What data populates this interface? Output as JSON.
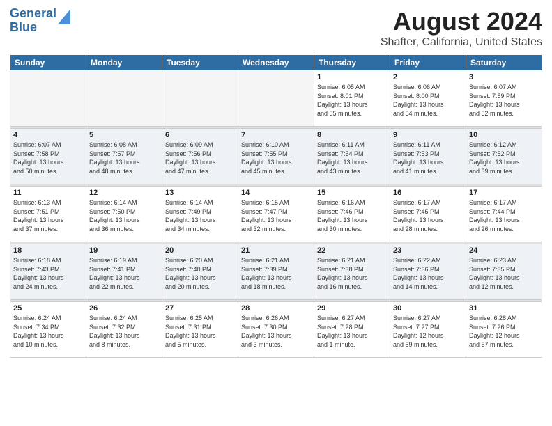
{
  "header": {
    "logo_line1": "General",
    "logo_line2": "Blue",
    "title": "August 2024",
    "subtitle": "Shafter, California, United States"
  },
  "days_of_week": [
    "Sunday",
    "Monday",
    "Tuesday",
    "Wednesday",
    "Thursday",
    "Friday",
    "Saturday"
  ],
  "weeks": [
    {
      "days": [
        {
          "num": "",
          "empty": true
        },
        {
          "num": "",
          "empty": true
        },
        {
          "num": "",
          "empty": true
        },
        {
          "num": "",
          "empty": true
        },
        {
          "num": "1",
          "rise": "6:05 AM",
          "set": "8:01 PM",
          "hours": "13 hours",
          "mins": "55 minutes"
        },
        {
          "num": "2",
          "rise": "6:06 AM",
          "set": "8:00 PM",
          "hours": "13 hours",
          "mins": "54 minutes"
        },
        {
          "num": "3",
          "rise": "6:07 AM",
          "set": "7:59 PM",
          "hours": "13 hours",
          "mins": "52 minutes"
        }
      ]
    },
    {
      "days": [
        {
          "num": "4",
          "rise": "6:07 AM",
          "set": "7:58 PM",
          "hours": "13 hours",
          "mins": "50 minutes"
        },
        {
          "num": "5",
          "rise": "6:08 AM",
          "set": "7:57 PM",
          "hours": "13 hours",
          "mins": "48 minutes"
        },
        {
          "num": "6",
          "rise": "6:09 AM",
          "set": "7:56 PM",
          "hours": "13 hours",
          "mins": "47 minutes"
        },
        {
          "num": "7",
          "rise": "6:10 AM",
          "set": "7:55 PM",
          "hours": "13 hours",
          "mins": "45 minutes"
        },
        {
          "num": "8",
          "rise": "6:11 AM",
          "set": "7:54 PM",
          "hours": "13 hours",
          "mins": "43 minutes"
        },
        {
          "num": "9",
          "rise": "6:11 AM",
          "set": "7:53 PM",
          "hours": "13 hours",
          "mins": "41 minutes"
        },
        {
          "num": "10",
          "rise": "6:12 AM",
          "set": "7:52 PM",
          "hours": "13 hours",
          "mins": "39 minutes"
        }
      ]
    },
    {
      "days": [
        {
          "num": "11",
          "rise": "6:13 AM",
          "set": "7:51 PM",
          "hours": "13 hours",
          "mins": "37 minutes"
        },
        {
          "num": "12",
          "rise": "6:14 AM",
          "set": "7:50 PM",
          "hours": "13 hours",
          "mins": "36 minutes"
        },
        {
          "num": "13",
          "rise": "6:14 AM",
          "set": "7:49 PM",
          "hours": "13 hours",
          "mins": "34 minutes"
        },
        {
          "num": "14",
          "rise": "6:15 AM",
          "set": "7:47 PM",
          "hours": "13 hours",
          "mins": "32 minutes"
        },
        {
          "num": "15",
          "rise": "6:16 AM",
          "set": "7:46 PM",
          "hours": "13 hours",
          "mins": "30 minutes"
        },
        {
          "num": "16",
          "rise": "6:17 AM",
          "set": "7:45 PM",
          "hours": "13 hours",
          "mins": "28 minutes"
        },
        {
          "num": "17",
          "rise": "6:17 AM",
          "set": "7:44 PM",
          "hours": "13 hours",
          "mins": "26 minutes"
        }
      ]
    },
    {
      "days": [
        {
          "num": "18",
          "rise": "6:18 AM",
          "set": "7:43 PM",
          "hours": "13 hours",
          "mins": "24 minutes"
        },
        {
          "num": "19",
          "rise": "6:19 AM",
          "set": "7:41 PM",
          "hours": "13 hours",
          "mins": "22 minutes"
        },
        {
          "num": "20",
          "rise": "6:20 AM",
          "set": "7:40 PM",
          "hours": "13 hours",
          "mins": "20 minutes"
        },
        {
          "num": "21",
          "rise": "6:21 AM",
          "set": "7:39 PM",
          "hours": "13 hours",
          "mins": "18 minutes"
        },
        {
          "num": "22",
          "rise": "6:21 AM",
          "set": "7:38 PM",
          "hours": "13 hours",
          "mins": "16 minutes"
        },
        {
          "num": "23",
          "rise": "6:22 AM",
          "set": "7:36 PM",
          "hours": "13 hours",
          "mins": "14 minutes"
        },
        {
          "num": "24",
          "rise": "6:23 AM",
          "set": "7:35 PM",
          "hours": "13 hours",
          "mins": "12 minutes"
        }
      ]
    },
    {
      "days": [
        {
          "num": "25",
          "rise": "6:24 AM",
          "set": "7:34 PM",
          "hours": "13 hours",
          "mins": "10 minutes"
        },
        {
          "num": "26",
          "rise": "6:24 AM",
          "set": "7:32 PM",
          "hours": "13 hours",
          "mins": "8 minutes"
        },
        {
          "num": "27",
          "rise": "6:25 AM",
          "set": "7:31 PM",
          "hours": "13 hours",
          "mins": "5 minutes"
        },
        {
          "num": "28",
          "rise": "6:26 AM",
          "set": "7:30 PM",
          "hours": "13 hours",
          "mins": "3 minutes"
        },
        {
          "num": "29",
          "rise": "6:27 AM",
          "set": "7:28 PM",
          "hours": "13 hours",
          "mins": "1 minute"
        },
        {
          "num": "30",
          "rise": "6:27 AM",
          "set": "7:27 PM",
          "hours": "12 hours",
          "mins": "59 minutes"
        },
        {
          "num": "31",
          "rise": "6:28 AM",
          "set": "7:26 PM",
          "hours": "12 hours",
          "mins": "57 minutes"
        }
      ]
    }
  ]
}
